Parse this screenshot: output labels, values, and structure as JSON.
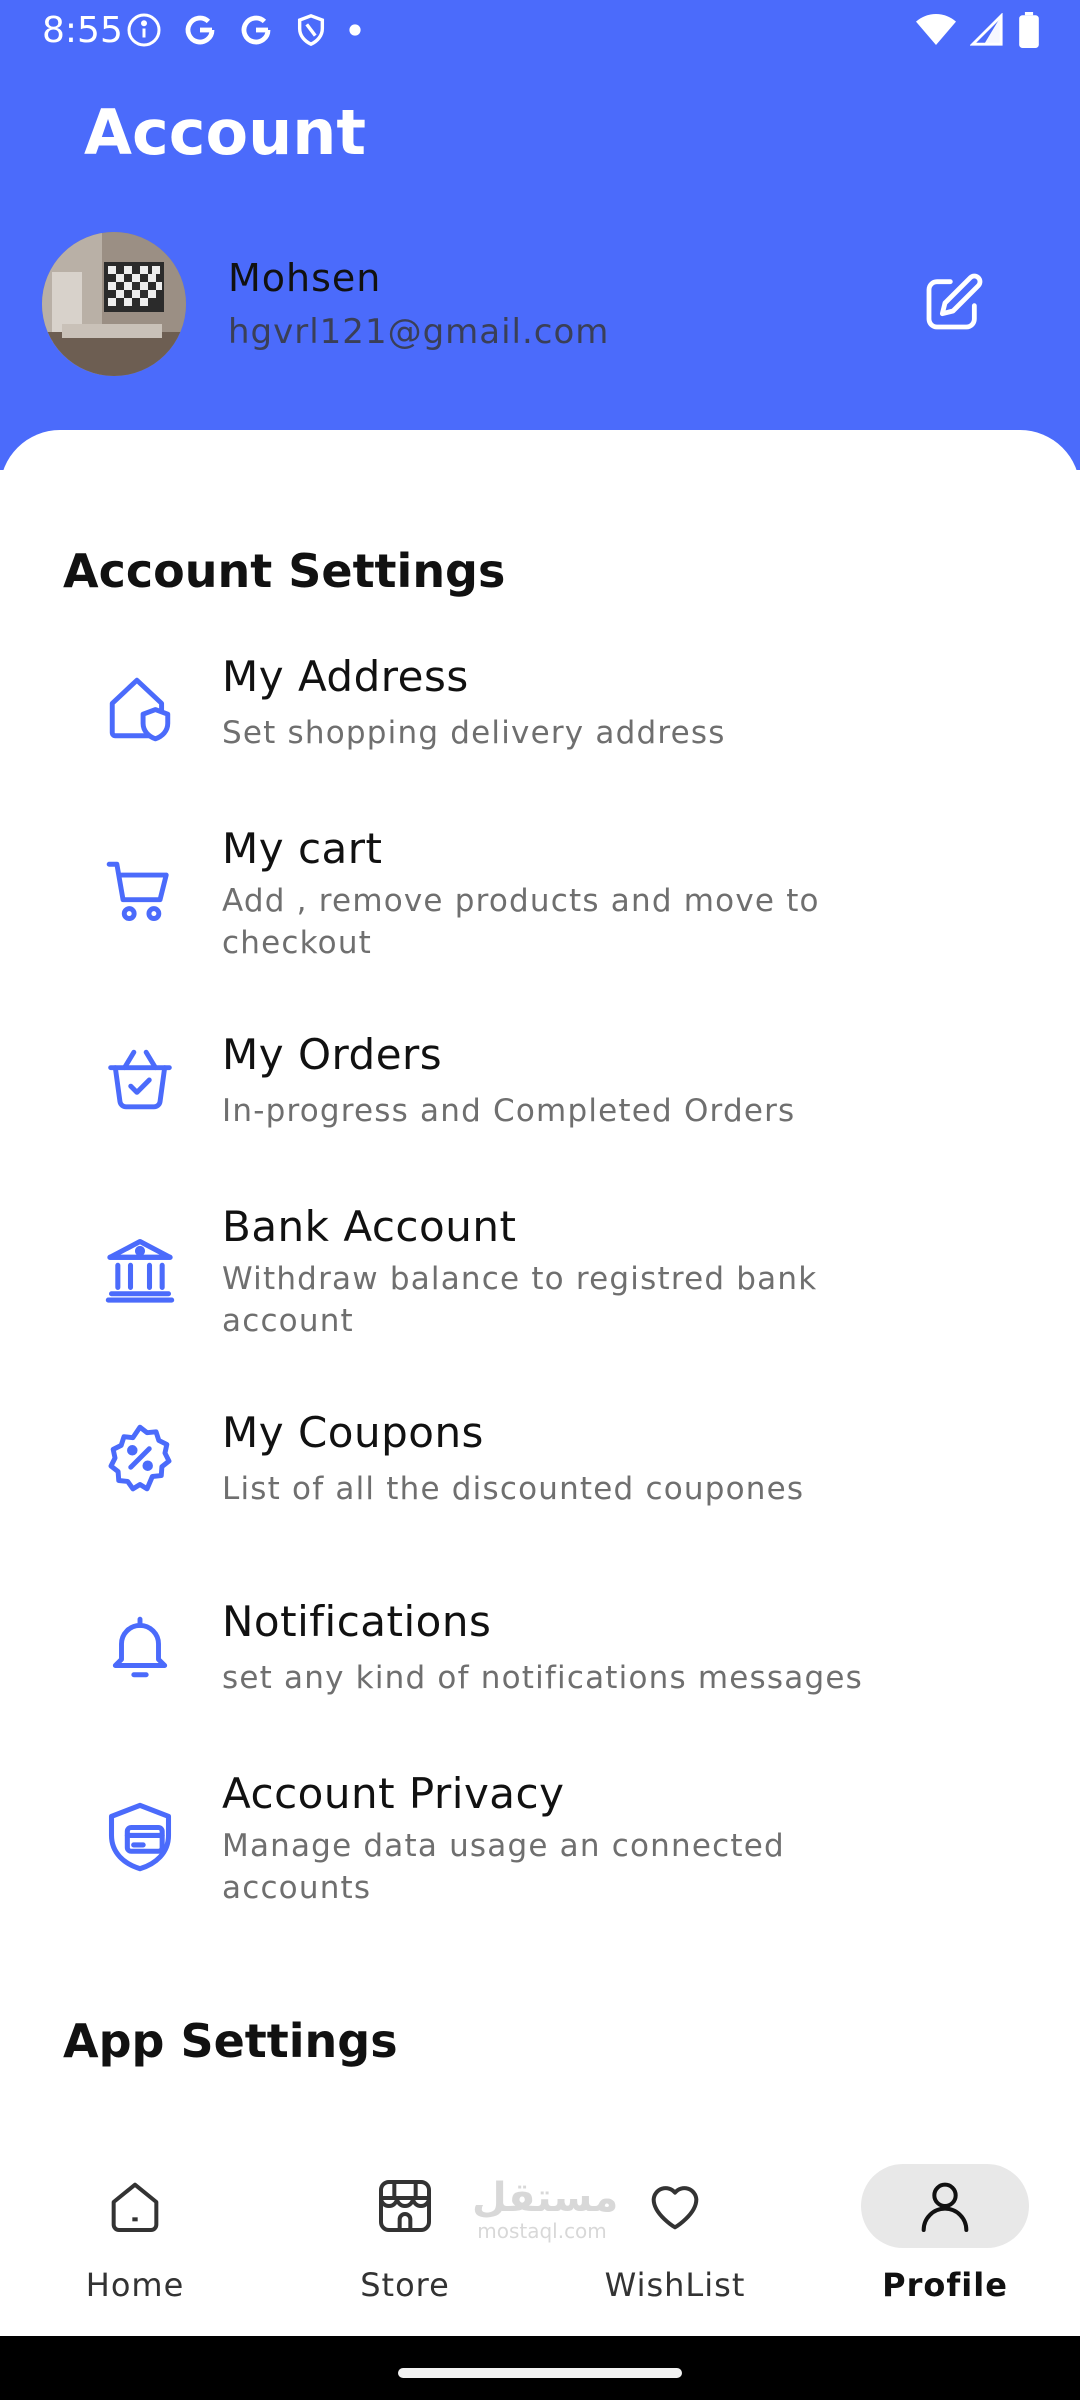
{
  "status": {
    "time": "8:55",
    "icons_left": [
      "info-icon",
      "google-icon",
      "google-icon",
      "shield-icon",
      "dot-icon"
    ],
    "icons_right": [
      "wifi-icon",
      "signal-icon",
      "battery-icon"
    ]
  },
  "header": {
    "title": "Account",
    "user_name": "Mohsen",
    "user_email": "hgvrl121@gmail.com",
    "background_color": "#4B6BFB"
  },
  "sections": {
    "account_settings": "Account Settings",
    "app_settings": "App Settings"
  },
  "items": [
    {
      "icon": "home-shield-icon",
      "title": "My Address",
      "subtitle": "Set shopping delivery address"
    },
    {
      "icon": "cart-icon",
      "title": "My cart",
      "subtitle": "Add , remove products and move to checkout"
    },
    {
      "icon": "basket-check-icon",
      "title": "My Orders",
      "subtitle": "In-progress and Completed Orders"
    },
    {
      "icon": "bank-icon",
      "title": "Bank Account",
      "subtitle": "Withdraw balance to registred bank account"
    },
    {
      "icon": "discount-badge-icon",
      "title": "My Coupons",
      "subtitle": "List of all the discounted coupones"
    },
    {
      "icon": "bell-icon",
      "title": "Notifications",
      "subtitle": "set any kind of notifications messages"
    },
    {
      "icon": "card-shield-icon",
      "title": "Account Privacy",
      "subtitle": "Manage data usage an connected accounts"
    }
  ],
  "nav": [
    {
      "icon": "home-icon",
      "label": "Home"
    },
    {
      "icon": "store-icon",
      "label": "Store"
    },
    {
      "icon": "heart-icon",
      "label": "WishList"
    },
    {
      "icon": "user-icon",
      "label": "Profile",
      "active": true
    }
  ],
  "watermark": {
    "arabic": "مستقل",
    "latin": "mostaql.com"
  },
  "colors": {
    "accent": "#4B6BFB",
    "icon": "#4B6BFB",
    "nav_active_bg": "#E8E8E8"
  }
}
